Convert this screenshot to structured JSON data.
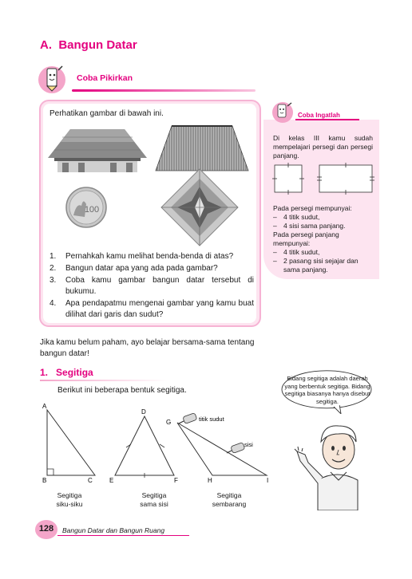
{
  "section": {
    "letter": "A.",
    "title": "Bangun Datar"
  },
  "coba_pikirkan": {
    "label": "Coba Pikirkan"
  },
  "intro": "Perhatikan gambar di bawah ini.",
  "images": {
    "roof1": "roof-trapezoid-image",
    "roof2": "thatched-roof-trapezoid-image",
    "coin": "coin-circle-image",
    "kite": "kite-rhombus-image",
    "coin_value": "100"
  },
  "questions": [
    {
      "num": "1.",
      "text": "Pernahkah kamu melihat benda-benda di atas?"
    },
    {
      "num": "2.",
      "text": "Bangun datar apa yang ada pada gambar?"
    },
    {
      "num": "3.",
      "text": "Coba kamu gambar bangun datar tersebut di bukumu."
    },
    {
      "num": "4.",
      "text": "Apa pendapatmu mengenai gambar yang kamu buat dilihat dari garis dan sudut?"
    }
  ],
  "coba_ingatlah": {
    "label": "Coba Ingatlah",
    "intro": "Di kelas III kamu sudah mempelajari persegi dan persegi panjang.",
    "persegi_title": "Pada persegi mempunyai:",
    "persegi_items": [
      "4 titik sudut,",
      "4 sisi sama panjang."
    ],
    "pp_title": "Pada persegi panjang mempunyai:",
    "pp_items": [
      "4 titik sudut,",
      "2 pasang sisi sejajar dan sama panjang."
    ],
    "dash": "–"
  },
  "paragraph": "Jika kamu belum paham, ayo belajar bersama-sama tentang bangun datar!",
  "segitiga": {
    "num": "1.",
    "title": "Segitiga",
    "intro": "Berikut ini beberapa bentuk segitiga.",
    "bubble": "Bidang segitiga adalah daerah yang berbentuk segitiga. Bidang segitiga biasanya hanya disebut segitiga.",
    "labels": {
      "A": "A",
      "B": "B",
      "C": "C",
      "D": "D",
      "E": "E",
      "F": "F",
      "G": "G",
      "H": "H",
      "I": "I"
    },
    "titik_sudut": "titik sudut",
    "sisi": "sisi",
    "captions": [
      {
        "line1": "Segitiga",
        "line2": "siku-siku"
      },
      {
        "line1": "Segitiga",
        "line2": "sama sisi"
      },
      {
        "line1": "Segitiga",
        "line2": "sembarang"
      }
    ]
  },
  "footer": {
    "page": "128",
    "text": "Bangun Datar dan Bangun Ruang"
  },
  "colors": {
    "accent": "#e4007f",
    "pink_light": "#fde4f0",
    "pink_border": "#f6b3d4"
  }
}
